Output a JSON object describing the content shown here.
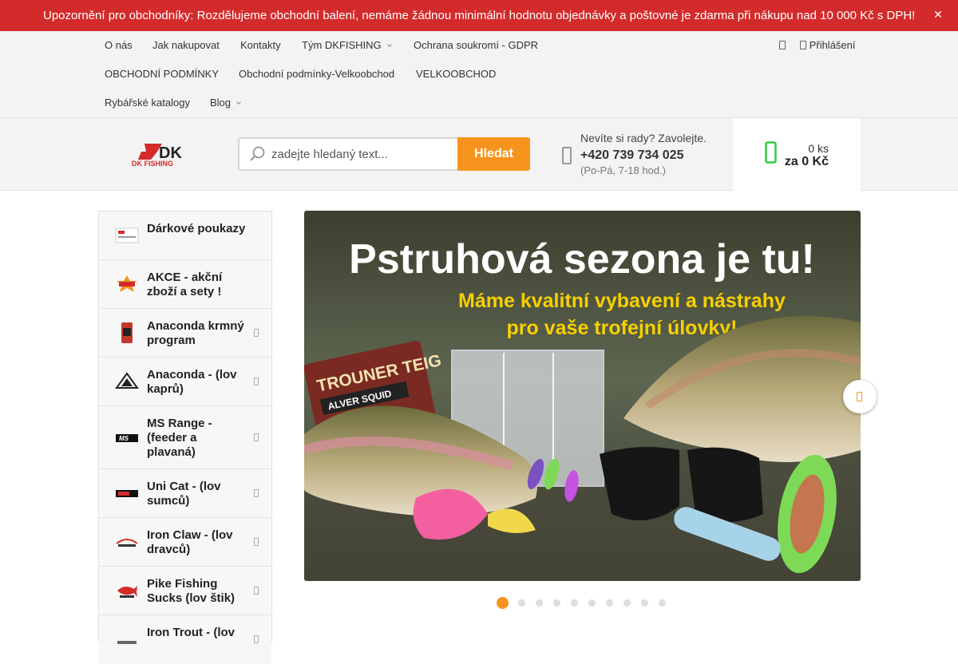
{
  "notice": {
    "text": "Upozornění pro obchodníky: Rozdělujeme obchodní balení, nemáme žádnou minimální hodnotu objednávky a poštovné je zdarma při nákupu nad 10 000 Kč s DPH!",
    "close_icon": "close-icon",
    "color": "#d32b2b"
  },
  "nav": {
    "row1": [
      "O nás",
      "Jak nakupovat",
      "Kontakty",
      "Tým DKFISHING",
      "Ochrana soukromí - GDPR"
    ],
    "row2": [
      "OBCHODNÍ PODMÍNKY",
      "Obchodní podmínky-Velkoobchod",
      "VELKOOBCHOD"
    ],
    "row3": [
      "Rybářské katalogy",
      "Blog"
    ],
    "login": "Přihlášení"
  },
  "header": {
    "logo_text": "DK FISHING",
    "logo_mark": "DK",
    "search_placeholder": "zadejte hledaný text...",
    "search_button": "Hledat",
    "help_line1": "Nevíte si rady? Zavolejte.",
    "phone": "+420 739 734 025",
    "hours": "(Po-Pá, 7-18 hod.)",
    "cart_count": "0 ks",
    "cart_total": "za 0 Kč",
    "accent": "#f7941d"
  },
  "sidebar": {
    "items": [
      {
        "label": "Dárkové poukazy",
        "has_submenu": false
      },
      {
        "label": "AKCE - akční zboží a sety !",
        "has_submenu": false
      },
      {
        "label": "Anaconda krmný program",
        "has_submenu": true
      },
      {
        "label": "Anaconda - (lov kaprů)",
        "has_submenu": true
      },
      {
        "label": "MS Range - (feeder a plavaná)",
        "has_submenu": true
      },
      {
        "label": "Uni Cat - (lov sumců)",
        "has_submenu": true
      },
      {
        "label": "Iron Claw - (lov dravců)",
        "has_submenu": true
      },
      {
        "label": "Pike Fishing Sucks (lov štik)",
        "has_submenu": true
      },
      {
        "label": "Iron Trout - (lov",
        "has_submenu": true
      }
    ]
  },
  "banner": {
    "headline": "Pstruhová sezona je tu!",
    "subline1": "Máme kvalitní vybavení a nástrahy",
    "subline2": "pro vaše trofejní úlovky!",
    "product_label1": "TROUNER TEIG",
    "product_label2": "ALVER SQUID",
    "slide_count": 10,
    "active_slide": 1
  }
}
